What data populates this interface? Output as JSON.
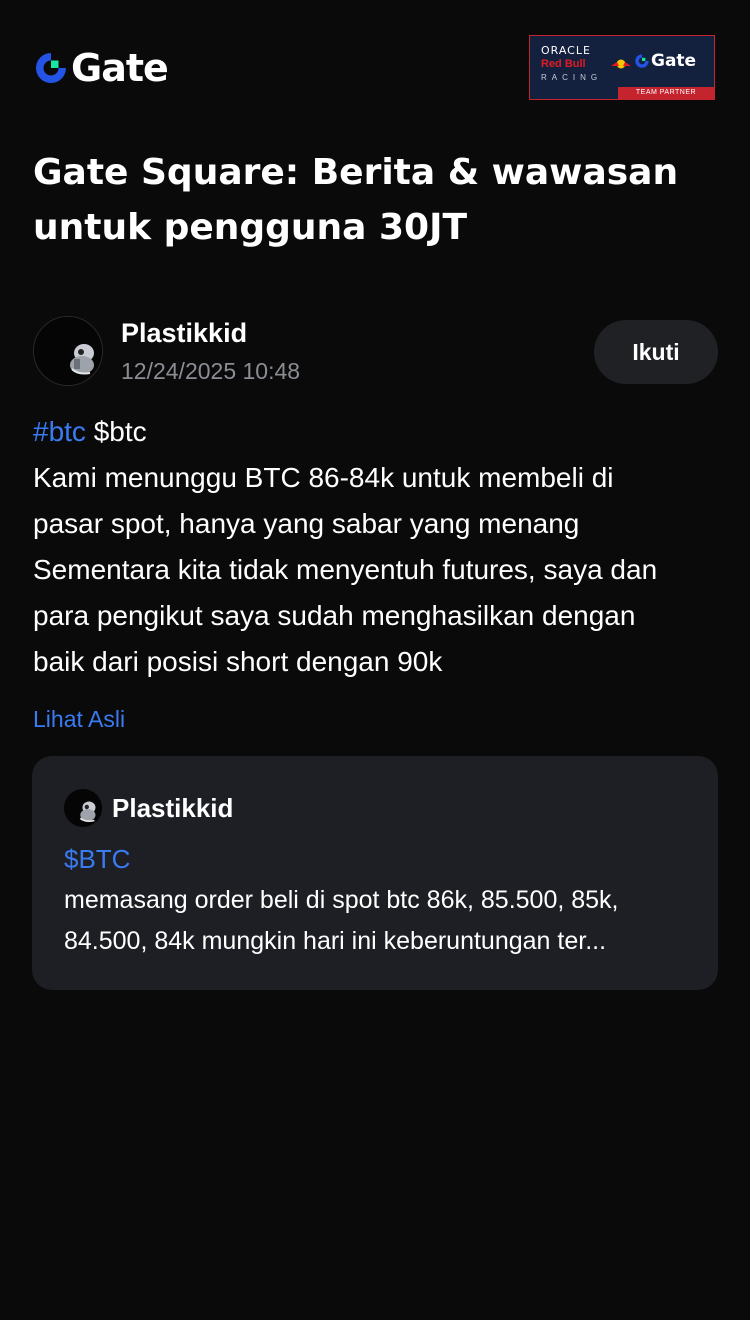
{
  "header": {
    "logo_text": "Gate",
    "partner_badge": {
      "line1": "ORACLE",
      "line2": "Red Bull",
      "line3": "RACING",
      "brand": "Gate",
      "footer": "TEAM PARTNER"
    }
  },
  "headline": "Gate Square: Berita & wawasan untuk pengguna 30JT",
  "post": {
    "author": "Plastikkid",
    "timestamp": "12/24/2025 10:48",
    "follow_label": "Ikuti",
    "hashtag": "#btc",
    "cashtag": "$btc",
    "lines": [
      "Kami menunggu BTC 86-84k untuk membeli di",
      "pasar spot, hanya yang sabar yang menang",
      "Sementara kita tidak menyentuh futures, saya dan",
      "para pengikut saya sudah menghasilkan dengan",
      "baik dari posisi short dengan 90k"
    ],
    "see_original_label": "Lihat Asli"
  },
  "quoted_post": {
    "author": "Plastikkid",
    "cashtag": "$BTC",
    "lines": [
      "memasang order beli di spot btc 86k, 85.500, 85k,",
      "84.500, 84k mungkin hari ini keberuntungan ter..."
    ]
  },
  "colors": {
    "background": "#0a0a0a",
    "accent_blue": "#3a7bf2",
    "muted_text": "#8a8d93",
    "card_background": "#1d1f24",
    "button_background": "#1f2124",
    "partner_red": "#c4242e",
    "partner_navy": "#13213f"
  },
  "icons": {
    "logo": "gate-logo-icon",
    "avatar": "user-avatar-icon"
  }
}
